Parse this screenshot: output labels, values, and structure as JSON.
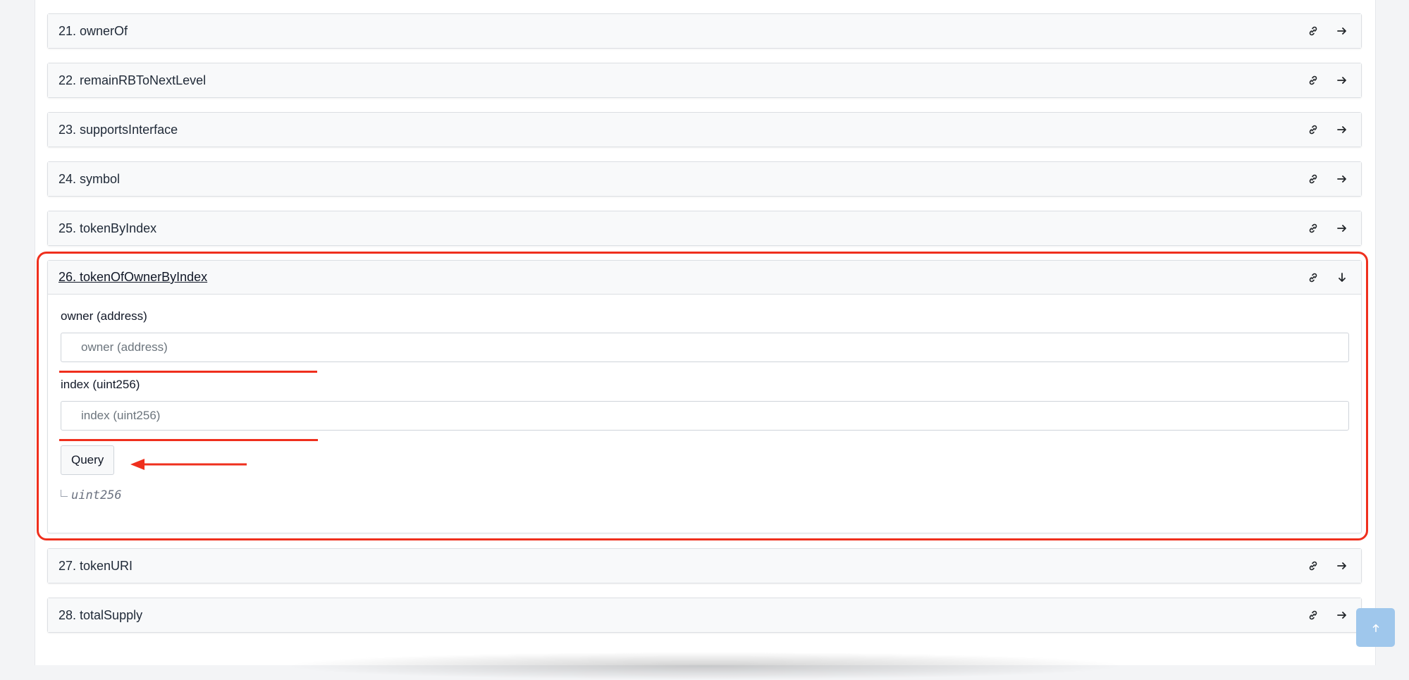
{
  "functions": [
    {
      "label": "21. ownerOf"
    },
    {
      "label": "22. remainRBToNextLevel"
    },
    {
      "label": "23. supportsInterface"
    },
    {
      "label": "24. symbol"
    },
    {
      "label": "25. tokenByIndex"
    }
  ],
  "expanded": {
    "label": "26. tokenOfOwnerByIndex",
    "inputs": [
      {
        "label": "owner (address)",
        "placeholder": "owner (address)",
        "value": ""
      },
      {
        "label": "index (uint256)",
        "placeholder": "index (uint256)",
        "value": ""
      }
    ],
    "query_label": "Query",
    "output_type": "uint256"
  },
  "functions_after": [
    {
      "label": "27. tokenURI"
    },
    {
      "label": "28. totalSupply"
    }
  ],
  "icons": {
    "link": "link-icon",
    "go": "arrow-right-icon",
    "collapse": "arrow-down-icon",
    "scroll_top": "arrow-up-icon"
  },
  "colors": {
    "annotation": "#ef2f1d",
    "scroll_top_bg": "#9fc7ec",
    "header_bg": "#f8f9fa"
  }
}
